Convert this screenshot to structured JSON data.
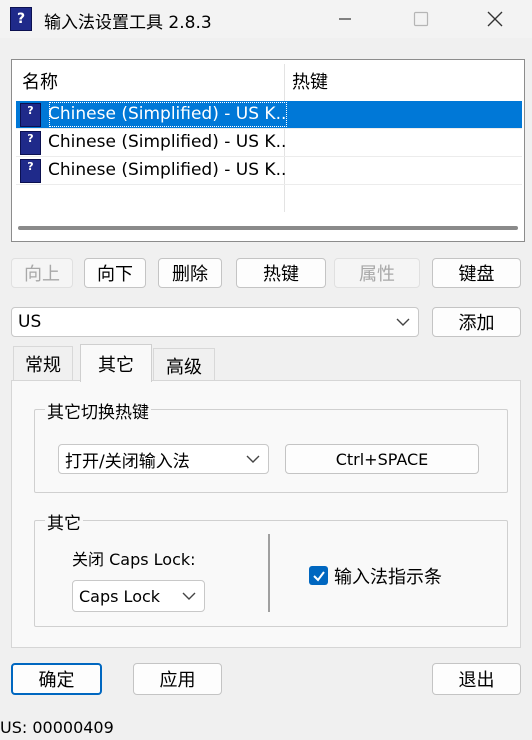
{
  "window": {
    "title": "输入法设置工具 2.8.3",
    "minimize_icon": "minimize-icon",
    "maximize_icon": "maximize-icon",
    "close_icon": "close-icon"
  },
  "list": {
    "columns": [
      "名称",
      "热键"
    ],
    "rows": [
      {
        "name": "Chinese (Simplified) - US K...",
        "hotkey": "",
        "selected": true
      },
      {
        "name": "Chinese (Simplified) - US K...",
        "hotkey": "",
        "selected": false
      },
      {
        "name": "Chinese (Simplified) - US K...",
        "hotkey": "",
        "selected": false
      }
    ]
  },
  "row_buttons": {
    "up": "向上",
    "down": "向下",
    "delete": "删除",
    "hotkey": "热键",
    "properties": "属性",
    "keyboard": "键盘"
  },
  "layout_select": {
    "value": "US",
    "add_label": "添加"
  },
  "tabs": [
    {
      "label": "常规",
      "active": false
    },
    {
      "label": "其它",
      "active": true
    },
    {
      "label": "高级",
      "active": false
    }
  ],
  "other_hotkey_group": {
    "title": "其它切换热键",
    "action_value": "打开/关闭输入法",
    "hotkey_button": "Ctrl+SPACE"
  },
  "other_group": {
    "title": "其它",
    "caps_label": "关闭 Caps Lock:",
    "caps_value": "Caps Lock",
    "indicator_label": "输入法指示条",
    "indicator_checked": true
  },
  "footer": {
    "ok": "确定",
    "apply": "应用",
    "exit": "退出"
  },
  "status": "US: 00000409",
  "colors": {
    "accent": "#0078d7",
    "default_button_border": "#0067c0",
    "icon_blue": "#1f2a8a"
  }
}
